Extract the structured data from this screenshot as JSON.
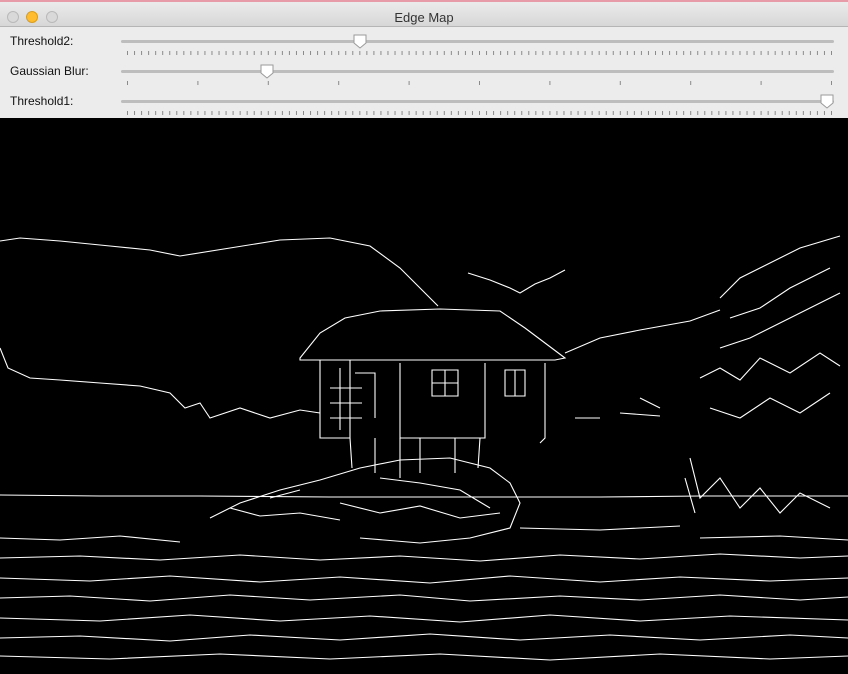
{
  "window": {
    "title": "Edge Map",
    "accent": "#febc2e"
  },
  "sliders": [
    {
      "label": "Threshold2:",
      "value": 0.335,
      "ticks": "fine"
    },
    {
      "label": "Gaussian Blur:",
      "value": 0.205,
      "ticks": "coarse"
    },
    {
      "label": "Threshold1:",
      "value": 0.99,
      "ticks": "fine"
    }
  ],
  "image": {
    "description_icon": "edge-map-image"
  }
}
